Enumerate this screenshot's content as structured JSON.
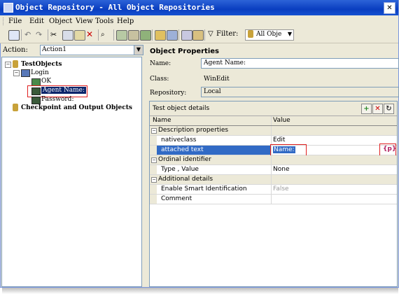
{
  "window": {
    "title": "Object Repository - All Object Repositories",
    "close_label": "✕"
  },
  "menu": [
    "File",
    "Edit",
    "Object",
    "View",
    "Tools",
    "Help"
  ],
  "toolbar": {
    "filter_label": "Filter:",
    "filter_value": "All Obje"
  },
  "left": {
    "action_label": "Action:",
    "action_value": "Action1",
    "tree": {
      "root": "TestObjects",
      "login": "Login",
      "ok": "OK",
      "agent_name": "Agent Name:",
      "password": "Password:",
      "checkpoints": "Checkpoint and Output Objects"
    }
  },
  "properties": {
    "heading": "Object Properties",
    "name_label": "Name:",
    "name_value": "Agent Name:",
    "class_label": "Class:",
    "class_value": "WinEdit",
    "repo_label": "Repository:",
    "repo_value": "Local"
  },
  "details": {
    "title": "Test object details",
    "col_name": "Name",
    "col_value": "Value",
    "rows": [
      {
        "name": "Description properties",
        "value": ""
      },
      {
        "name": "nativeclass",
        "value": "Edit"
      },
      {
        "name": "attached text",
        "value": "Name:"
      },
      {
        "name": "Ordinal identifier",
        "value": ""
      },
      {
        "name": "Type , Value",
        "value": "None"
      },
      {
        "name": "Additional details",
        "value": ""
      },
      {
        "name": "Enable Smart Identification",
        "value": "False"
      },
      {
        "name": "Comment",
        "value": ""
      }
    ],
    "param_icon": "{p}"
  },
  "colors": {
    "title_bar": "#0a3ec0",
    "selection": "#316ac5",
    "highlight_box": "#e02020"
  }
}
